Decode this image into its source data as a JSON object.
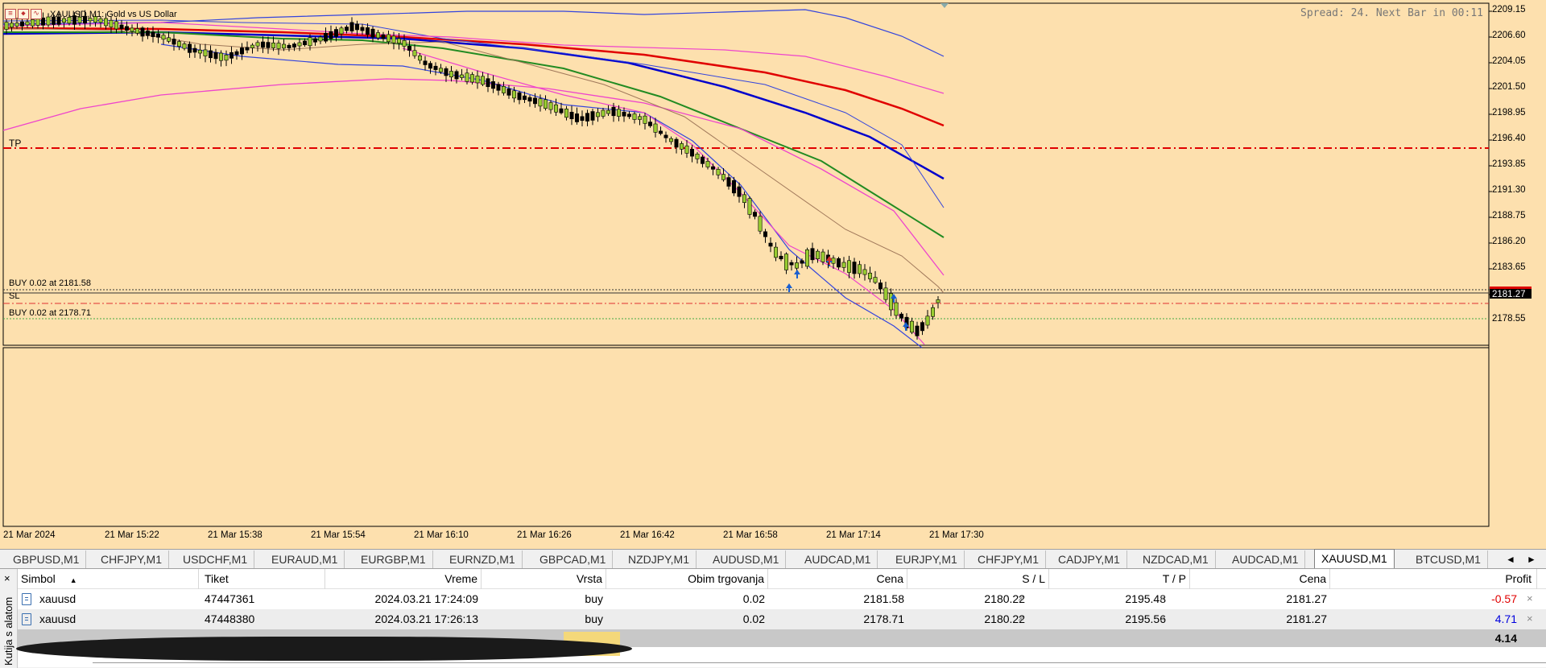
{
  "chart": {
    "title": "XAUUSD,M1:  Gold vs US Dollar",
    "spread_info": "Spread: 24. Next Bar in 00:11",
    "tp_label": "TP",
    "sl_label": "SL",
    "order1_label": "BUY 0.02 at 2181.58",
    "order2_label": "BUY 0.02 at 2178.71",
    "current_price": "2181.27",
    "y_axis_labels": [
      "2209.15",
      "2206.60",
      "2204.05",
      "2201.50",
      "2198.95",
      "2196.40",
      "2193.85",
      "2191.30",
      "2188.75",
      "2186.20",
      "2183.65",
      "2178.55"
    ],
    "x_axis_labels": [
      "21 Mar 2024",
      "21 Mar 15:22",
      "21 Mar 15:38",
      "21 Mar 15:54",
      "21 Mar 16:10",
      "21 Mar 16:26",
      "21 Mar 16:42",
      "21 Mar 16:58",
      "21 Mar 17:14",
      "21 Mar 17:30"
    ],
    "colors": {
      "background": "#fde0ae",
      "tp_line": "#e00000",
      "ma_red": "#e00000",
      "ma_blue": "#0000cc",
      "ma_green": "#228b22",
      "band_blue": "#3344dd",
      "band_magenta": "#ee44cc",
      "band_brown": "#a0785a",
      "bull_candle": "#9acd32",
      "bear_candle": "#000000"
    }
  },
  "tabs": {
    "items": [
      "GBPUSD,M1",
      "CHFJPY,M1",
      "USDCHF,M1",
      "EURAUD,M1",
      "EURGBP,M1",
      "EURNZD,M1",
      "GBPCAD,M1",
      "NZDJPY,M1",
      "AUDUSD,M1",
      "AUDCAD,M1",
      "EURJPY,M1",
      "CHFJPY,M1",
      "CADJPY,M1",
      "NZDCAD,M1",
      "AUDCAD,M1",
      "XAUUSD,M1",
      "BTCUSD,M1"
    ],
    "active": "XAUUSD,M1",
    "prev_arrow": "◄",
    "next_arrow": "►"
  },
  "terminal": {
    "close_glyph": "×",
    "side_label": "Kutija s alatom",
    "headers": {
      "symbol": "Simbol",
      "ticket": "Tiket",
      "time": "Vreme",
      "type": "Vrsta",
      "volume": "Obim trgovanja",
      "price": "Cena",
      "sl": "S / L",
      "tp": "T / P",
      "cur_price": "Cena",
      "profit": "Profit"
    },
    "rows": [
      {
        "symbol": "xauusd",
        "ticket": "47447361",
        "time": "2024.03.21 17:24:09",
        "type": "buy",
        "volume": "0.02",
        "price": "2181.58",
        "sl": "2180.22",
        "tp": "2195.48",
        "cur_price": "2181.27",
        "profit": "-0.57"
      },
      {
        "symbol": "xauusd",
        "ticket": "47448380",
        "time": "2024.03.21 17:26:13",
        "type": "buy",
        "volume": "0.02",
        "price": "2178.71",
        "sl": "2180.22",
        "tp": "2195.56",
        "cur_price": "2181.27",
        "profit": "4.71"
      }
    ],
    "total_profit": "4.14",
    "remove_glyph": "×"
  }
}
